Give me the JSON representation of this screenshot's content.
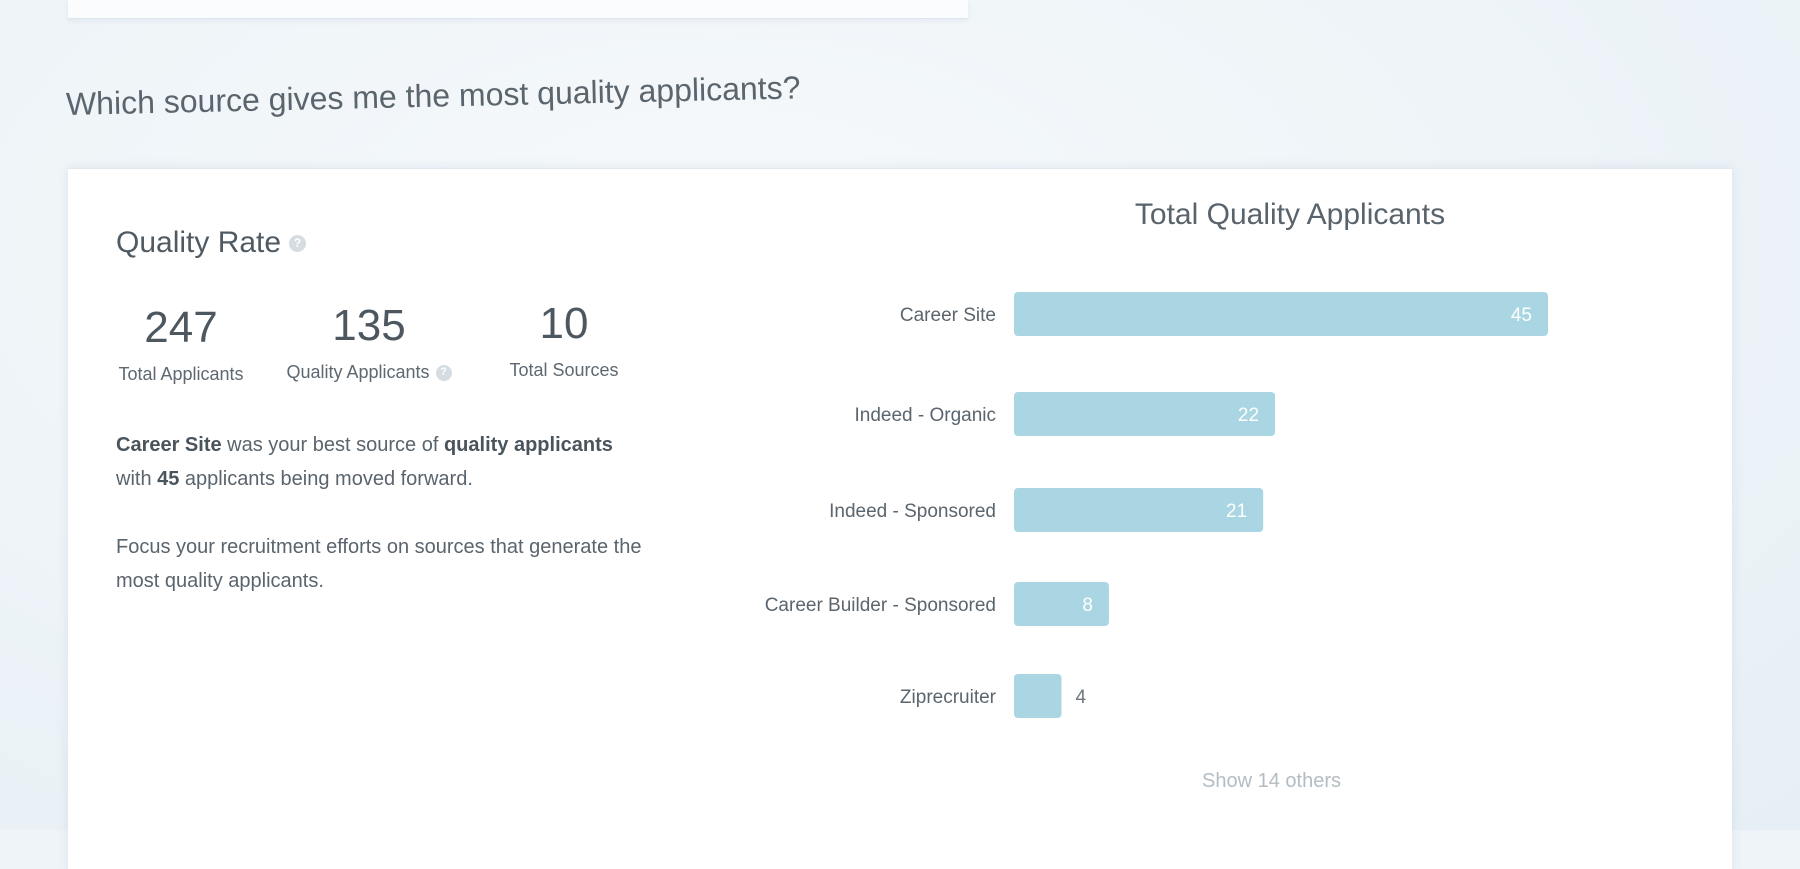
{
  "section": {
    "question": "Which source gives me the most quality applicants?"
  },
  "quality_rate": {
    "title": "Quality Rate",
    "help_icon": "question-circle-icon",
    "stats": [
      {
        "value": "247",
        "label": "Total Applicants"
      },
      {
        "value": "135",
        "label": "Quality Applicants",
        "help_icon": "question-circle-icon"
      },
      {
        "value": "10",
        "label": "Total Sources"
      }
    ],
    "insight": {
      "best_source": "Career Site",
      "line1_mid": " was your best source of ",
      "quality_phrase": "quality applicants",
      "line2_pre": "with ",
      "count": "45",
      "line2_post": " applicants being moved forward.",
      "advice": "Focus your recruitment efforts on sources that generate the most quality applicants."
    }
  },
  "chart_data": {
    "type": "bar",
    "orientation": "horizontal",
    "title": "Total Quality Applicants",
    "categories": [
      "Career Site",
      "Indeed - Organic",
      "Indeed - Sponsored",
      "Career Builder - Sponsored",
      "Ziprecruiter"
    ],
    "values": [
      45,
      22,
      21,
      8,
      4
    ],
    "xlim": [
      0,
      45
    ],
    "grid": false,
    "bar_color": "#a9d6e2"
  },
  "show_others": {
    "label": "Show 14 others"
  },
  "colors": {
    "background": "#eef4f8",
    "card": "#ffffff",
    "bar": "#a9d6e2",
    "text": "#4a5560",
    "muted": "#b3bcc3"
  }
}
